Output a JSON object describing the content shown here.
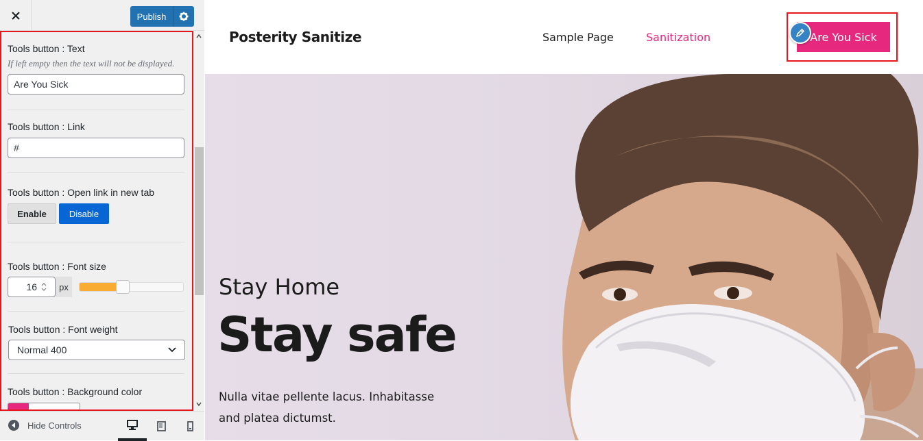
{
  "topbar": {
    "publish_label": "Publish"
  },
  "controls": {
    "text": {
      "label": "Tools button : Text",
      "description": "If left empty then the text will not be displayed.",
      "value": "Are You Sick"
    },
    "link": {
      "label": "Tools button : Link",
      "value": "#"
    },
    "new_tab": {
      "label": "Tools button : Open link in new tab",
      "enable_label": "Enable",
      "disable_label": "Disable",
      "selected": "Disable"
    },
    "font_size": {
      "label": "Tools button : Font size",
      "value": "16",
      "unit": "px",
      "slider_fraction": 0.42
    },
    "font_weight": {
      "label": "Tools button : Font weight",
      "selected": "Normal 400"
    },
    "bg_color": {
      "label": "Tools button : Background color",
      "value": "#e6287f"
    }
  },
  "footer": {
    "hide_controls_label": "Hide Controls",
    "active_device": "desktop"
  },
  "preview": {
    "site_title": "Posterity Sanitize",
    "nav": [
      {
        "label": "Sample Page",
        "color": "#1b1b1b"
      },
      {
        "label": "Sanitization",
        "color": "#e6287f"
      }
    ],
    "cta_label": "Are You Sick",
    "hero": {
      "subtitle": "Stay Home",
      "title": "Stay safe",
      "text": "Nulla vitae pellente lacus. Inhabitasse and platea dictumst."
    }
  },
  "colors": {
    "accent": "#e6287f",
    "wp_blue": "#2271b1",
    "highlight": "#e8161b",
    "slider": "#f8ac34"
  }
}
